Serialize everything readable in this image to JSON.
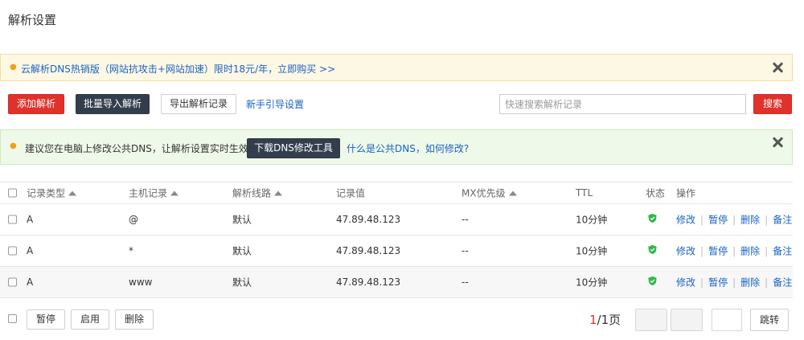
{
  "page": {
    "title": "解析设置"
  },
  "notice": {
    "text": "云解析DNS热销版（网站抗攻击+网站加速）限时18元/年，立即购买 >>"
  },
  "toolbar": {
    "add_label": "添加解析",
    "batch_import_label": "批量导入解析",
    "export_label": "导出解析记录",
    "guide_label": "新手引导设置",
    "search_placeholder": "快速搜索解析记录",
    "search_label": "搜索"
  },
  "tip": {
    "text": "建议您在电脑上修改公共DNS，让解析设置实时生效。",
    "download_label": "下载DNS修改工具",
    "link_label": "什么是公共DNS，如何修改?"
  },
  "table": {
    "headers": {
      "type": "记录类型",
      "host": "主机记录",
      "line": "解析线路",
      "value": "记录值",
      "mx": "MX优先级",
      "ttl": "TTL",
      "status": "状态",
      "ops": "操作"
    },
    "rows": [
      {
        "type": "A",
        "host": "@",
        "line": "默认",
        "value": "47.89.48.123",
        "mx": "--",
        "ttl": "10分钟"
      },
      {
        "type": "A",
        "host": "*",
        "line": "默认",
        "value": "47.89.48.123",
        "mx": "--",
        "ttl": "10分钟"
      },
      {
        "type": "A",
        "host": "www",
        "line": "默认",
        "value": "47.89.48.123",
        "mx": "--",
        "ttl": "10分钟"
      }
    ],
    "ops": {
      "edit": "修改",
      "pause": "暂停",
      "delete": "删除",
      "note": "备注"
    }
  },
  "footer": {
    "pause_label": "暂停",
    "enable_label": "启用",
    "delete_label": "删除",
    "page_current": "1",
    "page_total": "/1页",
    "jump_label": "跳转"
  },
  "colors": {
    "primary_red": "#e0312b",
    "dark_button": "#333e4d",
    "link_blue": "#1a62c5",
    "status_green": "#2fb84a"
  }
}
